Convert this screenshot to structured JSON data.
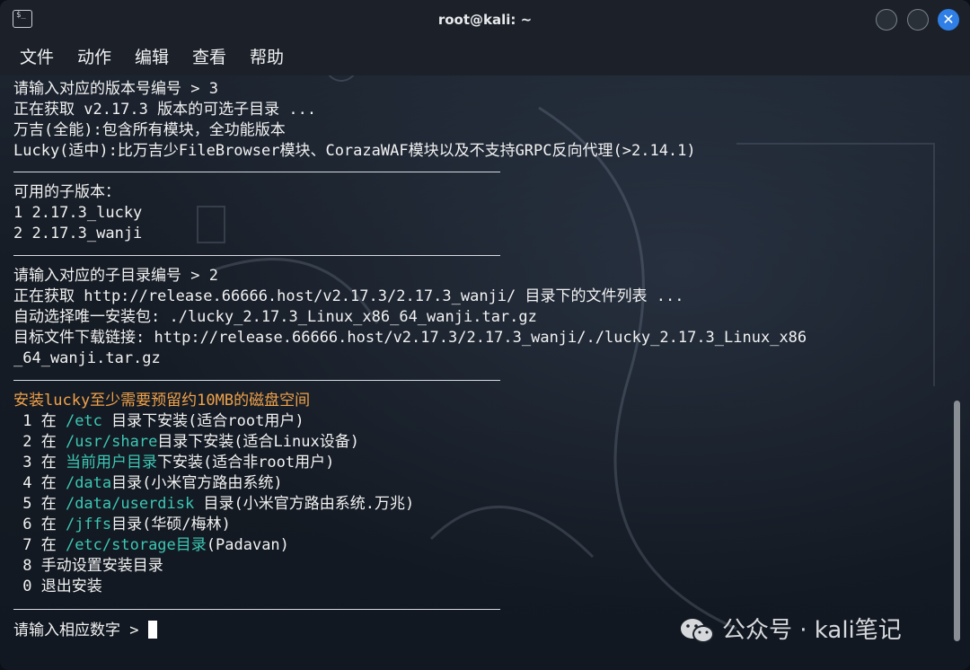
{
  "window": {
    "title": "root@kali: ~",
    "close_glyph": "✕",
    "term_icon_glyph": "$_"
  },
  "menu": [
    "文件",
    "动作",
    "编辑",
    "查看",
    "帮助"
  ],
  "terminal": {
    "lines": [
      "请输入对应的版本号编号 > 3",
      "正在获取 v2.17.3 版本的可选子目录 ...",
      "万吉(全能):包含所有模块，全功能版本",
      "Lucky(适中):比万吉少FileBrowser模块、CorazaWAF模块以及不支持GRPC反向代理(>2.14.1)",
      "可用的子版本：",
      "1 2.17.3_lucky",
      "2 2.17.3_wanji",
      "请输入对应的子目录编号 > 2",
      "正在获取 http://release.66666.host/v2.17.3/2.17.3_wanji/ 目录下的文件列表 ...",
      "自动选择唯一安装包: ./lucky_2.17.3_Linux_x86_64_wanji.tar.gz",
      "目标文件下载链接: http://release.66666.host/v2.17.3/2.17.3_wanji/./lucky_2.17.3_Linux_x86",
      "_64_wanji.tar.gz",
      "安装lucky至少需要预留约10MB的磁盘空间"
    ],
    "options": [
      {
        "pre": " 1 在 ",
        "path": "/etc",
        "post": " 目录下安装(适合root用户)"
      },
      {
        "pre": " 2 在 ",
        "path": "/usr/share",
        "post": "目录下安装(适合Linux设备)"
      },
      {
        "pre": " 3 在 ",
        "path": "当前用户目录",
        "post": "下安装(适合非root用户)"
      },
      {
        "pre": " 4 在 ",
        "path": "/data",
        "post": "目录(小米官方路由系统)"
      },
      {
        "pre": " 5 在 ",
        "path": "/data/userdisk",
        "post": " 目录(小米官方路由系统.万兆)"
      },
      {
        "pre": " 6 在 ",
        "path": "/jffs",
        "post": "目录(华硕/梅林)"
      },
      {
        "pre": " 7 在 ",
        "path": "/etc/storage目录",
        "post": "(Padavan)"
      },
      {
        "pre": " 8 手动设置安装目录",
        "path": "",
        "post": ""
      },
      {
        "pre": " 0 退出安装",
        "path": "",
        "post": ""
      }
    ],
    "prompt": "请输入相应数字 > "
  },
  "watermark": {
    "text": "公众号 · kali笔记"
  },
  "colors": {
    "path": "#3cc7b4",
    "warning": "#f0a24a",
    "close_button": "#2f7fe6"
  }
}
